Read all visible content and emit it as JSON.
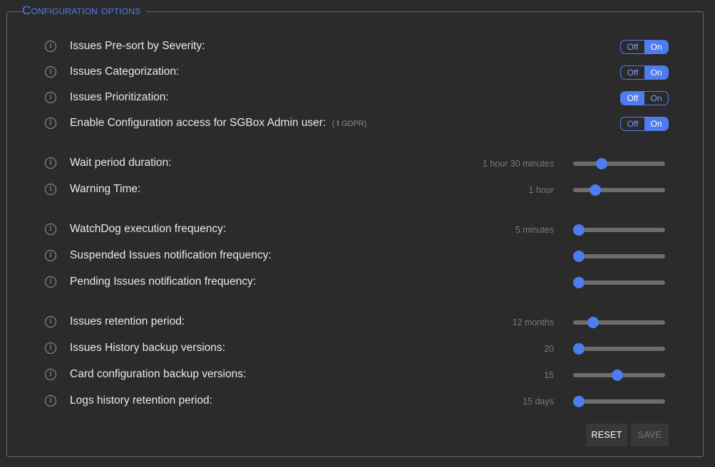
{
  "section": {
    "legend": "Configuration options"
  },
  "toggles": [
    {
      "label": "Issues Pre-sort by Severity:",
      "off": "Off",
      "on": "On",
      "state": "on"
    },
    {
      "label": "Issues Categorization:",
      "off": "Off",
      "on": "On",
      "state": "on"
    },
    {
      "label": "Issues Prioritization:",
      "off": "Off",
      "on": "On",
      "state": "off"
    },
    {
      "label": "Enable Configuration access for SGBox Admin user:",
      "off": "Off",
      "on": "On",
      "state": "on",
      "note": {
        "open": "(",
        "mark": "!",
        "text": "GDPR",
        "close": ")"
      }
    }
  ],
  "sliders": [
    {
      "label": "Wait period duration:",
      "value": "1 hour 30 minutes",
      "level": 0.31
    },
    {
      "label": "Warning Time:",
      "value": "1 hour",
      "level": 0.24
    },
    {
      "label": "WatchDog execution frequency:",
      "value": "5 minutes",
      "level": 0.06
    },
    {
      "label": "Suspended Issues notification frequency:",
      "value": "",
      "level": 0.06
    },
    {
      "label": "Pending Issues notification frequency:",
      "value": "",
      "level": 0.06
    },
    {
      "label": "Issues retention period:",
      "value": "12 months",
      "level": 0.22
    },
    {
      "label": "Issues History backup versions:",
      "value": "20",
      "level": 0.06
    },
    {
      "label": "Card configuration backup versions:",
      "value": "15",
      "level": 0.48
    },
    {
      "label": "Logs history retention period:",
      "value": "15 days",
      "level": 0.06
    }
  ],
  "buttons": {
    "reset": "RESET",
    "save": "SAVE"
  },
  "colors": {
    "accent": "#4e7df0",
    "background": "#2b2b2b",
    "warning": "#e39a2a"
  },
  "icons": {
    "info": "info-circle-icon"
  }
}
